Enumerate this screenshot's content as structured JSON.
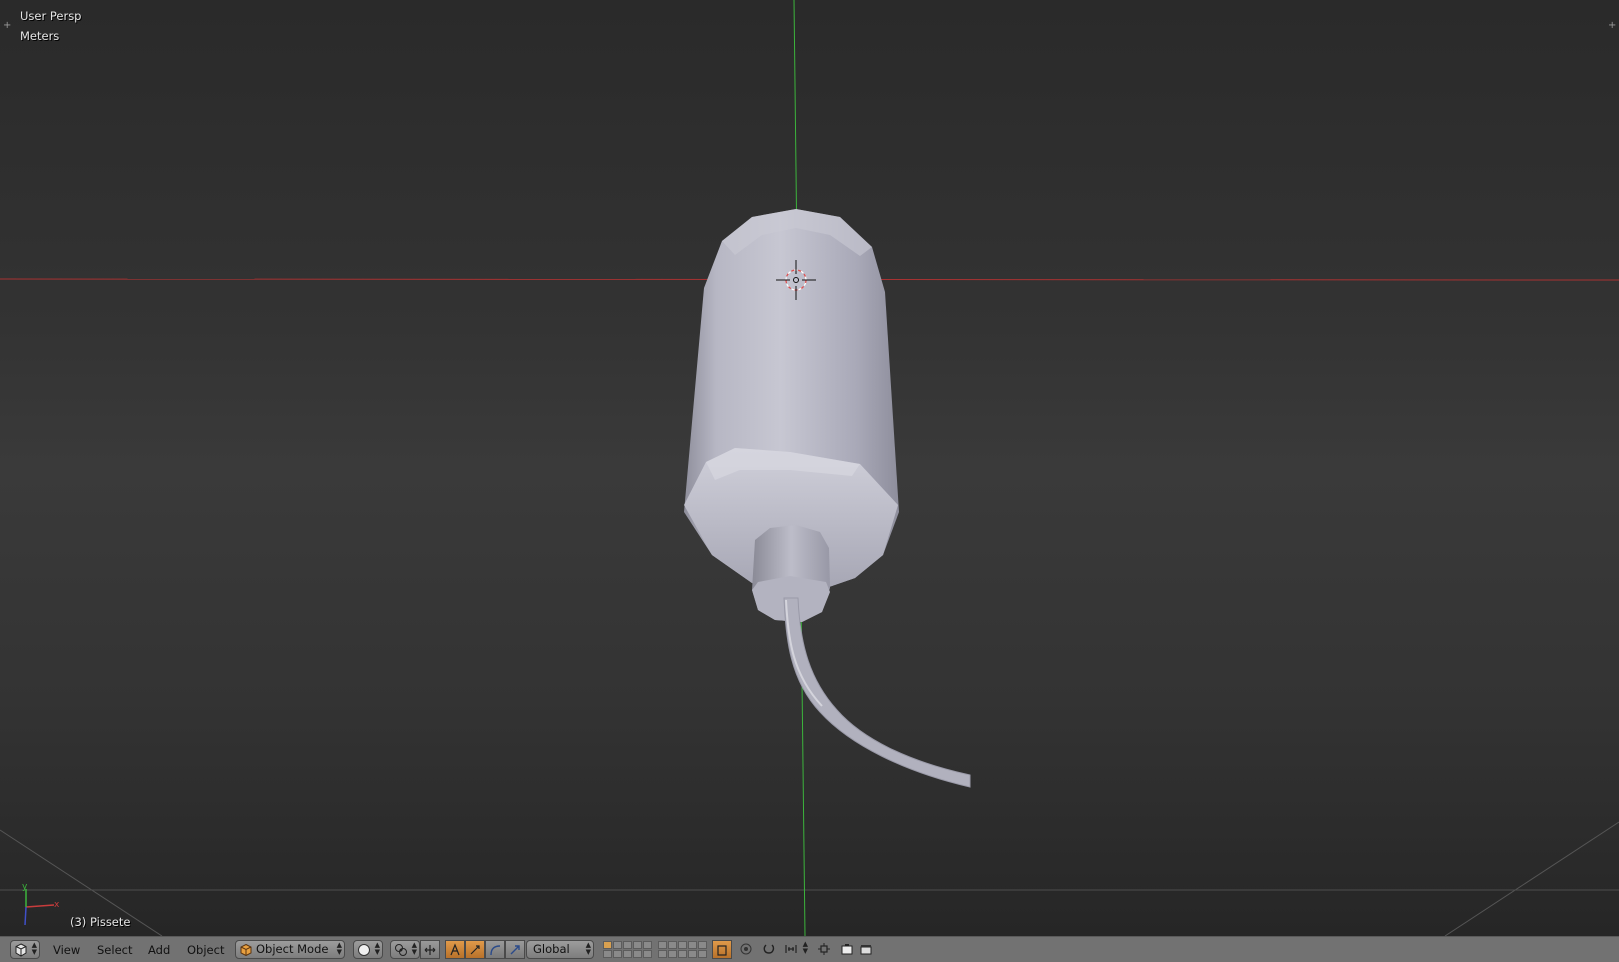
{
  "viewport": {
    "view_label": "User Persp",
    "units_label": "Meters",
    "object_label": "(3) Pissete",
    "axis_x_label": "x",
    "axis_y_label": "y",
    "axis_x_color": "#c83c3c",
    "axis_y_color": "#3cb43c",
    "object_color": "#b9b9c6"
  },
  "header": {
    "editor_type_icon": "3d-view-icon",
    "menus": {
      "view": "View",
      "select": "Select",
      "add": "Add",
      "object": "Object"
    },
    "mode": {
      "label": "Object Mode",
      "icon": "object-cube-icon"
    },
    "viewport_shading_icon": "solid-sphere-icon",
    "pivot_icon": "pivot-point-icon",
    "manipulator_icon": "manipulator-icon",
    "transform_orientation": "Global",
    "active_color": "#d9903a"
  }
}
